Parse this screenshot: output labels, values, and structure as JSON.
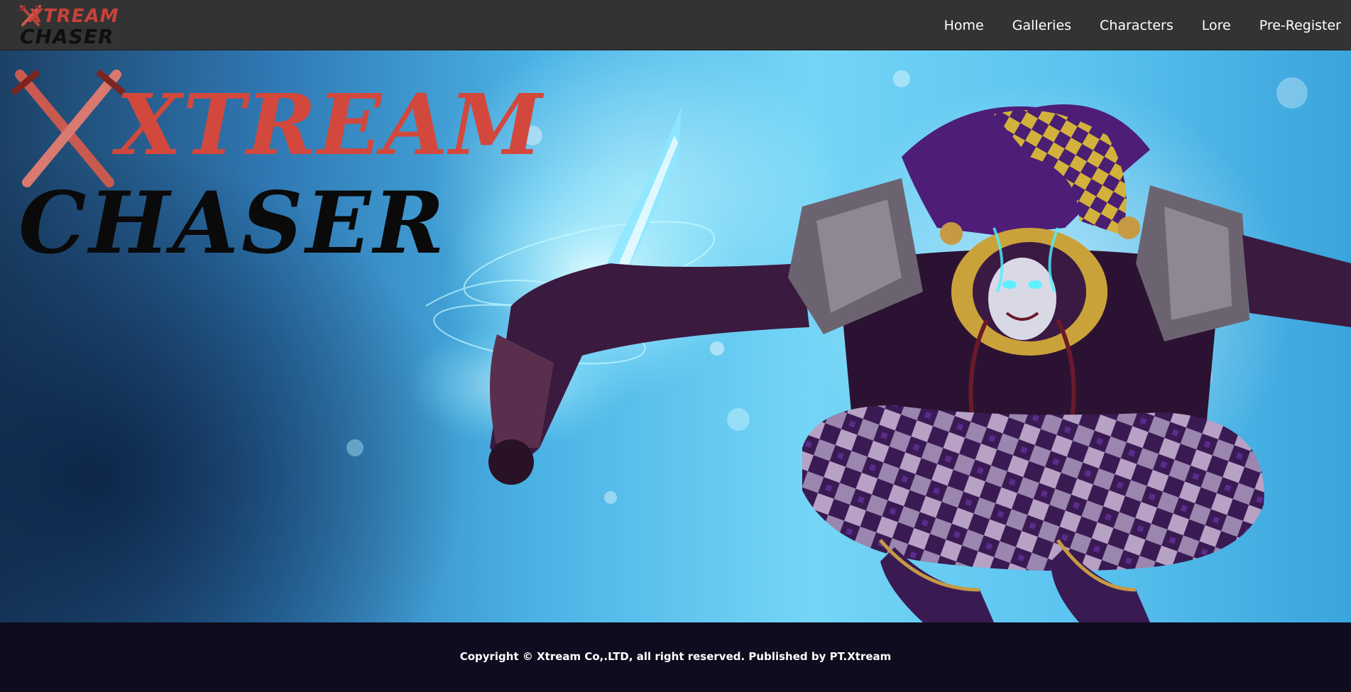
{
  "header": {
    "brand": {
      "line1": "XTREAM",
      "line2": "CHASER",
      "icon": "crossed-swords-icon"
    },
    "nav": [
      {
        "label": "Home"
      },
      {
        "label": "Galleries"
      },
      {
        "label": "Characters"
      },
      {
        "label": "Lore"
      },
      {
        "label": "Pre-Register"
      }
    ]
  },
  "hero": {
    "logo": {
      "line1": "XTREAM",
      "line2": "CHASER"
    },
    "colors": {
      "logo_red": "#d2483d",
      "logo_black": "#0a0a0a",
      "sky_blue": "#4bb3e6"
    }
  },
  "footer": {
    "copyright": "Copyright © Xtream Co,.LTD, all right reserved. Published by PT.Xtream"
  },
  "colors": {
    "header_bg": "#333333",
    "footer_bg": "#0e0c1e",
    "nav_text": "#ffffff"
  }
}
